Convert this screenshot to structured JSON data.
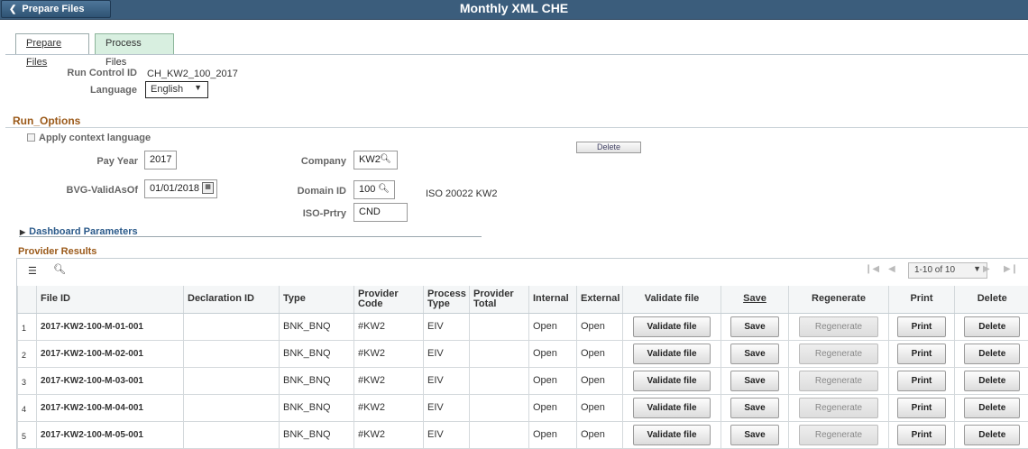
{
  "header": {
    "back_label": "Prepare Files",
    "title": "Monthly XML CHE"
  },
  "tabs": [
    {
      "label": "Prepare Files",
      "active": false
    },
    {
      "label": "Process Files",
      "active": true
    }
  ],
  "run_control": {
    "id_label": "Run Control ID",
    "id_value": "CH_KW2_100_2017",
    "language_label": "Language",
    "language_value": "English"
  },
  "run_options": {
    "title": "Run_Options",
    "apply_context_label": "Apply context language",
    "delete_label": "Delete",
    "pay_year_label": "Pay Year",
    "pay_year_value": "2017",
    "bvg_label": "BVG-ValidAsOf",
    "bvg_value": "01/01/2018",
    "company_label": "Company",
    "company_value": "KW2",
    "domain_label": "Domain ID",
    "domain_value": "100",
    "domain_desc": "ISO 20022 KW2",
    "iso_label": "ISO-Prtry",
    "iso_value": "CND",
    "dashboard_label": "Dashboard Parameters"
  },
  "provider_results": {
    "title": "Provider Results",
    "pager": "1-10 of 10",
    "columns": [
      "File ID",
      "Declaration ID",
      "Type",
      "Provider Code",
      "Process Type",
      "Provider Total",
      "Internal",
      "External",
      "Validate file",
      "Save",
      "Regenerate",
      "Print",
      "Delete"
    ],
    "rows": [
      {
        "num": "1",
        "file_id": "2017-KW2-100-M-01-001",
        "decl": "",
        "type": "BNK_BNQ",
        "code": "#KW2",
        "ptype": "EIV",
        "ptotal": "",
        "internal": "Open",
        "external": "Open"
      },
      {
        "num": "2",
        "file_id": "2017-KW2-100-M-02-001",
        "decl": "",
        "type": "BNK_BNQ",
        "code": "#KW2",
        "ptype": "EIV",
        "ptotal": "",
        "internal": "Open",
        "external": "Open"
      },
      {
        "num": "3",
        "file_id": "2017-KW2-100-M-03-001",
        "decl": "",
        "type": "BNK_BNQ",
        "code": "#KW2",
        "ptype": "EIV",
        "ptotal": "",
        "internal": "Open",
        "external": "Open"
      },
      {
        "num": "4",
        "file_id": "2017-KW2-100-M-04-001",
        "decl": "",
        "type": "BNK_BNQ",
        "code": "#KW2",
        "ptype": "EIV",
        "ptotal": "",
        "internal": "Open",
        "external": "Open"
      },
      {
        "num": "5",
        "file_id": "2017-KW2-100-M-05-001",
        "decl": "",
        "type": "BNK_BNQ",
        "code": "#KW2",
        "ptype": "EIV",
        "ptotal": "",
        "internal": "Open",
        "external": "Open"
      }
    ],
    "buttons": {
      "validate": "Validate file",
      "save": "Save",
      "regenerate": "Regenerate",
      "print": "Print",
      "delete": "Delete"
    }
  },
  "icons": [
    "chevron-left-icon",
    "dropdown-arrow-icon",
    "search-icon",
    "calendar-icon",
    "checkbox-icon",
    "disclosure-triangle-icon",
    "grid-personalize-icon",
    "first-page-icon",
    "prev-page-icon",
    "next-page-icon",
    "last-page-icon"
  ],
  "colors": {
    "header_bg": "#3b5d7c",
    "active_tab_bg": "#d8efe0",
    "section_title": "#9b5a1a",
    "link": "#2b5a8a"
  }
}
